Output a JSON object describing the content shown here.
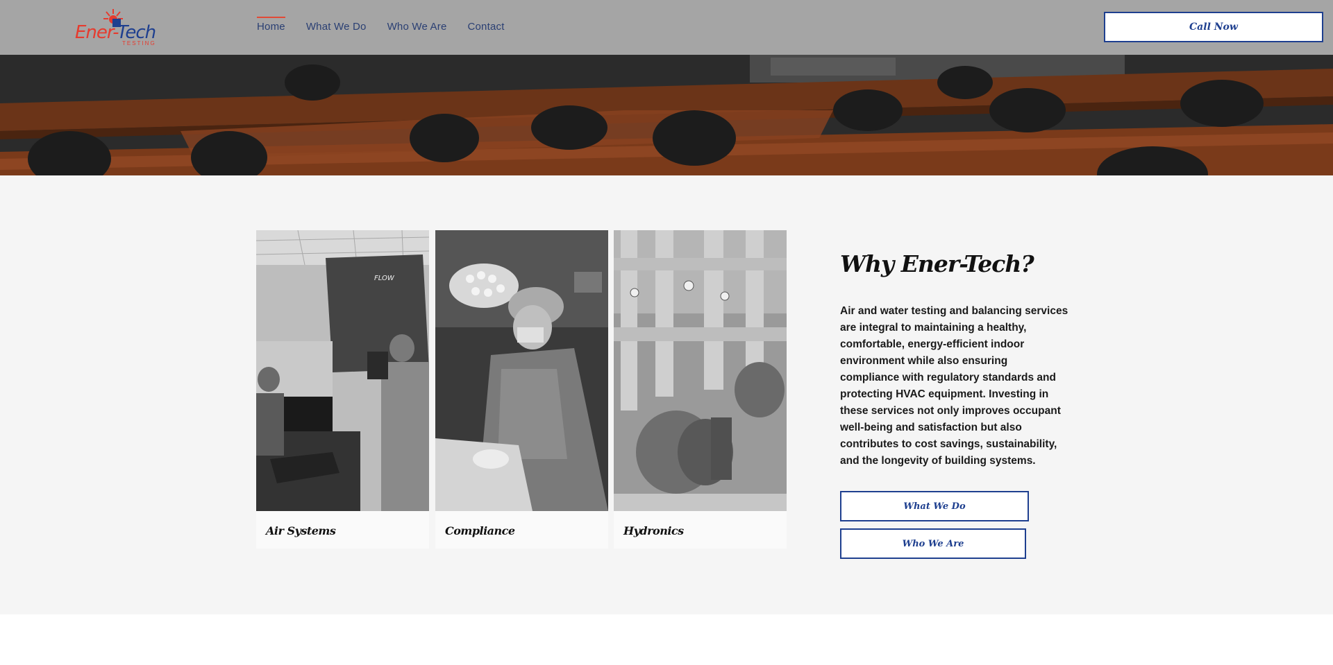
{
  "header": {
    "logo": {
      "word_part1": "Ener-",
      "word_part2": "Tech",
      "subtitle": "TESTING"
    },
    "nav": [
      {
        "label": "Home",
        "active": true
      },
      {
        "label": "What We Do",
        "active": false
      },
      {
        "label": "Who We Are",
        "active": false
      },
      {
        "label": "Contact",
        "active": false
      }
    ],
    "call_label": "Call Now"
  },
  "cards": [
    {
      "label": "Air Systems",
      "image": "technicians-with-airflow-equipment"
    },
    {
      "label": "Compliance",
      "image": "surgeon-in-operating-room"
    },
    {
      "label": "Hydronics",
      "image": "pumps-and-piping"
    }
  ],
  "why": {
    "title": "Why Ener-Tech?",
    "text": "Air and water testing and balancing services are integral to maintaining a healthy, comfortable, energy-efficient indoor environment while also ensuring compliance with regulatory standards and protecting HVAC equipment. Investing in these services not only improves occupant well-being and satisfaction but also contributes to cost savings, sustainability, and the longevity of building systems.",
    "buttons": [
      "What We Do",
      "Who We Are"
    ]
  },
  "colors": {
    "brand_blue": "#1e3f8f",
    "brand_red": "#e63b2e",
    "header_bg": "#a5a5a5",
    "section_bg": "#f5f5f5"
  }
}
